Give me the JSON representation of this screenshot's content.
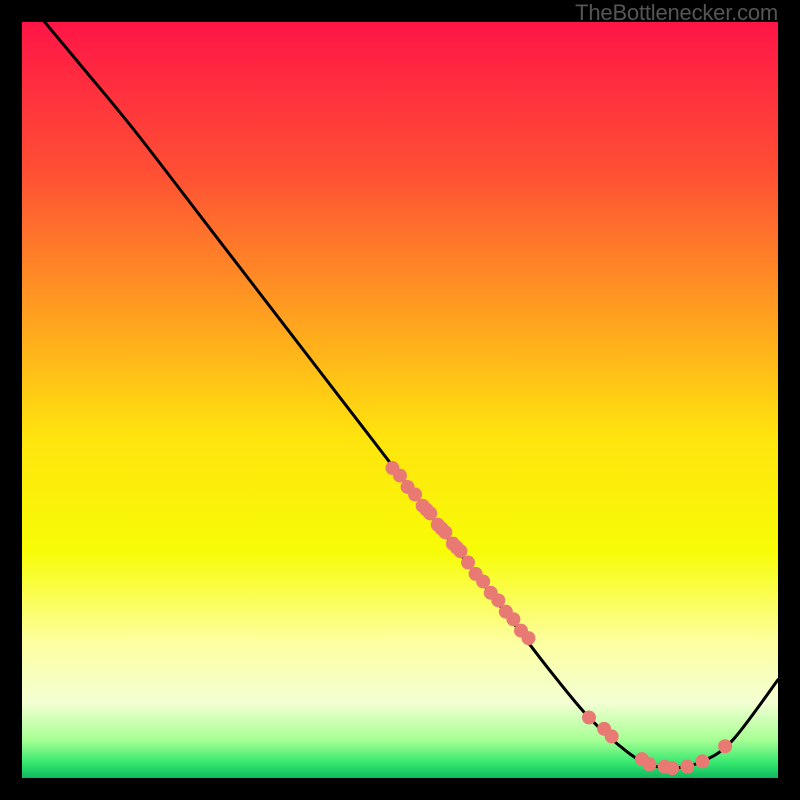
{
  "watermark": "TheBottlenecker.com",
  "chart_data": {
    "type": "line",
    "title": "",
    "xlabel": "",
    "ylabel": "",
    "xlim": [
      0,
      100
    ],
    "ylim": [
      0,
      100
    ],
    "background": {
      "gradient_type": "vertical",
      "stops": [
        {
          "pos": 0.0,
          "color": "#ff1547"
        },
        {
          "pos": 0.2,
          "color": "#ff5034"
        },
        {
          "pos": 0.4,
          "color": "#ffa51e"
        },
        {
          "pos": 0.55,
          "color": "#ffe40e"
        },
        {
          "pos": 0.7,
          "color": "#f7fc06"
        },
        {
          "pos": 0.82,
          "color": "#fdffa0"
        },
        {
          "pos": 0.9,
          "color": "#f3ffd3"
        },
        {
          "pos": 0.95,
          "color": "#a6ff94"
        },
        {
          "pos": 0.98,
          "color": "#35e86e"
        },
        {
          "pos": 1.0,
          "color": "#0fb85f"
        }
      ]
    },
    "series": [
      {
        "name": "bottleneck-curve",
        "type": "line",
        "x": [
          3,
          8,
          15,
          25,
          35,
          45,
          50,
          55,
          60,
          65,
          70,
          75,
          80,
          83,
          86,
          90,
          94,
          100
        ],
        "y": [
          100,
          94,
          85.5,
          72.5,
          59.5,
          46.5,
          40,
          33.5,
          27,
          20.5,
          14,
          8,
          3.5,
          1.8,
          1.3,
          2.2,
          5,
          13
        ]
      },
      {
        "name": "cluster-points",
        "type": "scatter",
        "color": "#e97a73",
        "x": [
          49,
          50,
          51,
          52,
          53,
          53.5,
          54,
          55,
          55.5,
          56,
          57,
          57.5,
          58,
          59,
          60,
          61,
          62,
          63,
          64,
          65,
          66,
          67,
          75,
          77,
          78,
          82,
          83,
          85,
          86,
          88,
          90,
          93
        ],
        "y": [
          41,
          40,
          38.5,
          37.5,
          36,
          35.5,
          35,
          33.5,
          33,
          32.5,
          31,
          30.5,
          30,
          28.5,
          27,
          26,
          24.5,
          23.5,
          22,
          21,
          19.5,
          18.5,
          8,
          6.5,
          5.5,
          2.5,
          1.8,
          1.5,
          1.3,
          1.5,
          2.2,
          4.2
        ]
      }
    ]
  }
}
